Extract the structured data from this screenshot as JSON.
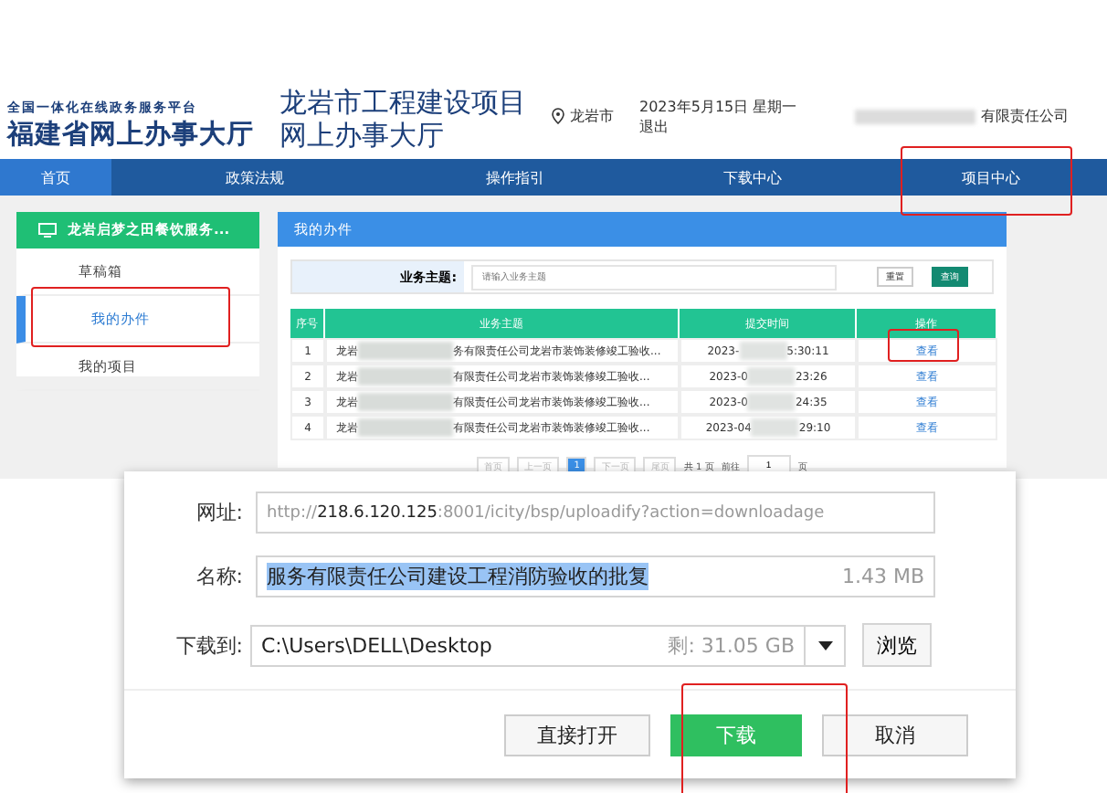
{
  "header": {
    "logo_top": "全国一体化在线政务服务平台",
    "logo_main": "福建省网上办事大厅",
    "title_line1": "龙岩市工程建设项目",
    "title_line2": "网上办事大厅",
    "location": "龙岩市",
    "date": "2023年5月15日 星期一",
    "logout": "退出",
    "company": "有限责任公司"
  },
  "nav": [
    {
      "label": "首页",
      "selected": true
    },
    {
      "label": "政策法规",
      "selected": false
    },
    {
      "label": "操作指引",
      "selected": false
    },
    {
      "label": "下载中心",
      "selected": false
    },
    {
      "label": "项目中心",
      "selected": false
    }
  ],
  "sidebar": {
    "title": "龙岩启梦之田餐饮服务...",
    "items": [
      {
        "label": "草稿箱",
        "selected": false
      },
      {
        "label": "我的办件",
        "selected": true
      },
      {
        "label": "我的项目",
        "selected": false
      }
    ]
  },
  "panel": {
    "title": "我的办件",
    "search_label": "业务主题:",
    "search_placeholder": "请输入业务主题",
    "reset": "重置",
    "query": "查询",
    "columns": [
      "序号",
      "业务主题",
      "提交时间",
      "操作"
    ],
    "rows": [
      {
        "index": "1",
        "subject_start": "龙岩",
        "subject_end": "务有限责任公司龙岩市装饰装修竣工验收...",
        "time_start": "2023-",
        "time_end": "5:30:11",
        "action": "查看"
      },
      {
        "index": "2",
        "subject_start": "龙岩",
        "subject_end": "有限责任公司龙岩市装饰装修竣工验收...",
        "time_start": "2023-0",
        "time_end": "23:26",
        "action": "查看"
      },
      {
        "index": "3",
        "subject_start": "龙岩",
        "subject_end": "有限责任公司龙岩市装饰装修竣工验收...",
        "time_start": "2023-0",
        "time_end": "24:35",
        "action": "查看"
      },
      {
        "index": "4",
        "subject_start": "龙岩",
        "subject_end": "有限责任公司龙岩市装饰装修竣工验收...",
        "time_start": "2023-04",
        "time_end": "29:10",
        "action": "查看"
      }
    ],
    "pagination": {
      "first": "首页",
      "prev": "上一页",
      "pages": [
        {
          "label": "1",
          "selected": true
        }
      ],
      "next": "下一页",
      "last": "尾页",
      "total": "共 1 页",
      "goto": "前往",
      "goto_value": "1",
      "page_unit": "页"
    }
  },
  "dialog": {
    "url_label": "网址:",
    "url": "http://**218.6.120.125**:8001/icity/bsp/uploadify?action=downloadage",
    "name_label": "名称:",
    "name": "服务有限责任公司建设工程消防验收的批复",
    "size": "1.43 MB",
    "save_label": "下载到:",
    "path": "C:\\Users\\DELL\\Desktop",
    "free": "剩: 31.05 GB",
    "browse": "浏览",
    "buttons": [
      {
        "label": "直接打开",
        "kind": "default"
      },
      {
        "label": "下载",
        "kind": "primary"
      },
      {
        "label": "取消",
        "kind": "default"
      }
    ]
  }
}
